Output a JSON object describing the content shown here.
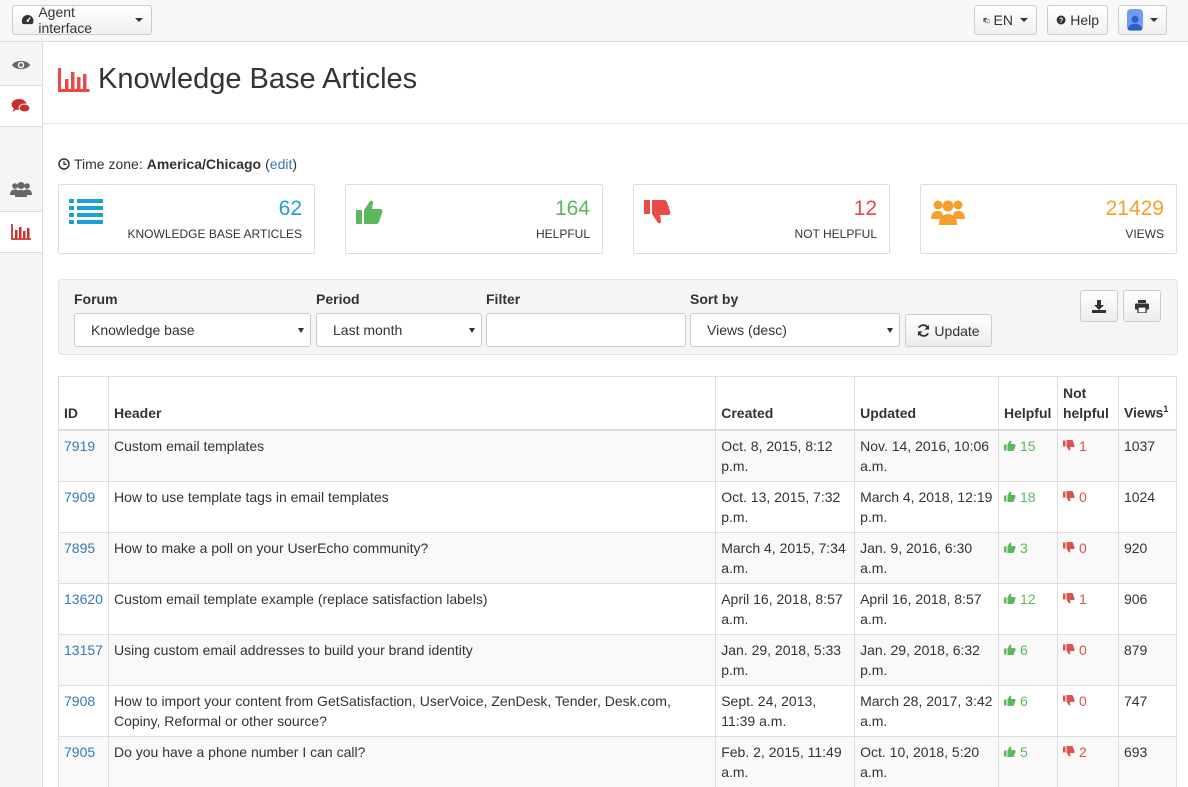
{
  "topbar": {
    "agent_label": "Agent interface",
    "lang_label": "EN",
    "help_label": "Help"
  },
  "sidebar": {
    "items": [
      "eye-icon",
      "comments-icon",
      "users-icon",
      "bar-chart-icon"
    ]
  },
  "page": {
    "title": "Knowledge Base Articles"
  },
  "timezone": {
    "label": "Time zone:",
    "value": "America/Chicago",
    "edit": "edit"
  },
  "stats": [
    {
      "value": "62",
      "label": "KNOWLEDGE BASE ARTICLES",
      "color": "#1ba1d6",
      "icon": "list-icon"
    },
    {
      "value": "164",
      "label": "HELPFUL",
      "color": "#5cb85c",
      "icon": "thumbs-up-icon"
    },
    {
      "value": "12",
      "label": "NOT HELPFUL",
      "color": "#e84a4a",
      "icon": "thumbs-down-icon"
    },
    {
      "value": "21429",
      "label": "VIEWS",
      "color": "#f5a02a",
      "icon": "users-icon"
    }
  ],
  "filters": {
    "forum_label": "Forum",
    "forum_value": "Knowledge base",
    "period_label": "Period",
    "period_value": "Last month",
    "filter_label": "Filter",
    "filter_value": "",
    "sort_label": "Sort by",
    "sort_value": "Views (desc)",
    "update_label": "Update"
  },
  "table": {
    "headers": {
      "id": "ID",
      "header": "Header",
      "created": "Created",
      "updated": "Updated",
      "helpful": "Helpful",
      "not_helpful": "Not helpful",
      "views": "Views",
      "views_sup": "1"
    },
    "rows": [
      {
        "id": "7919",
        "header": "Custom email templates",
        "created": "Oct. 8, 2015, 8:12 p.m.",
        "updated": "Nov. 14, 2016, 10:06 a.m.",
        "updated_muted": false,
        "helpful": "15",
        "not_helpful": "1",
        "views": "1037"
      },
      {
        "id": "7909",
        "header": "How to use template tags in email templates",
        "created": "Oct. 13, 2015, 7:32 p.m.",
        "updated": "March 4, 2018, 12:19 p.m.",
        "updated_muted": false,
        "helpful": "18",
        "not_helpful": "0",
        "views": "1024"
      },
      {
        "id": "7895",
        "header": "How to make a poll on your UserEcho community?",
        "created": "March 4, 2015, 7:34 a.m.",
        "updated": "Jan. 9, 2016, 6:30 a.m.",
        "updated_muted": false,
        "helpful": "3",
        "not_helpful": "0",
        "views": "920"
      },
      {
        "id": "13620",
        "header": "Custom email template example (replace satisfaction labels)",
        "created": "April 16, 2018, 8:57 a.m.",
        "updated": "April 16, 2018, 8:57 a.m.",
        "updated_muted": true,
        "helpful": "12",
        "not_helpful": "1",
        "views": "906"
      },
      {
        "id": "13157",
        "header": "Using custom email addresses to build your brand identity",
        "created": "Jan. 29, 2018, 5:33 p.m.",
        "updated": "Jan. 29, 2018, 6:32 p.m.",
        "updated_muted": false,
        "helpful": "6",
        "not_helpful": "0",
        "views": "879"
      },
      {
        "id": "7908",
        "header": "How to import your content from GetSatisfaction, UserVoice, ZenDesk, Tender, Desk.com, Copiny, Reformal or other source?",
        "created": "Sept. 24, 2013, 11:39 a.m.",
        "updated": "March 28, 2017, 3:42 a.m.",
        "updated_muted": false,
        "helpful": "6",
        "not_helpful": "0",
        "views": "747"
      },
      {
        "id": "7905",
        "header": "Do you have a phone number I can call?",
        "created": "Feb. 2, 2015, 11:49 a.m.",
        "updated": "Oct. 10, 2018, 5:20 a.m.",
        "updated_muted": false,
        "helpful": "5",
        "not_helpful": "2",
        "views": "693"
      }
    ]
  }
}
